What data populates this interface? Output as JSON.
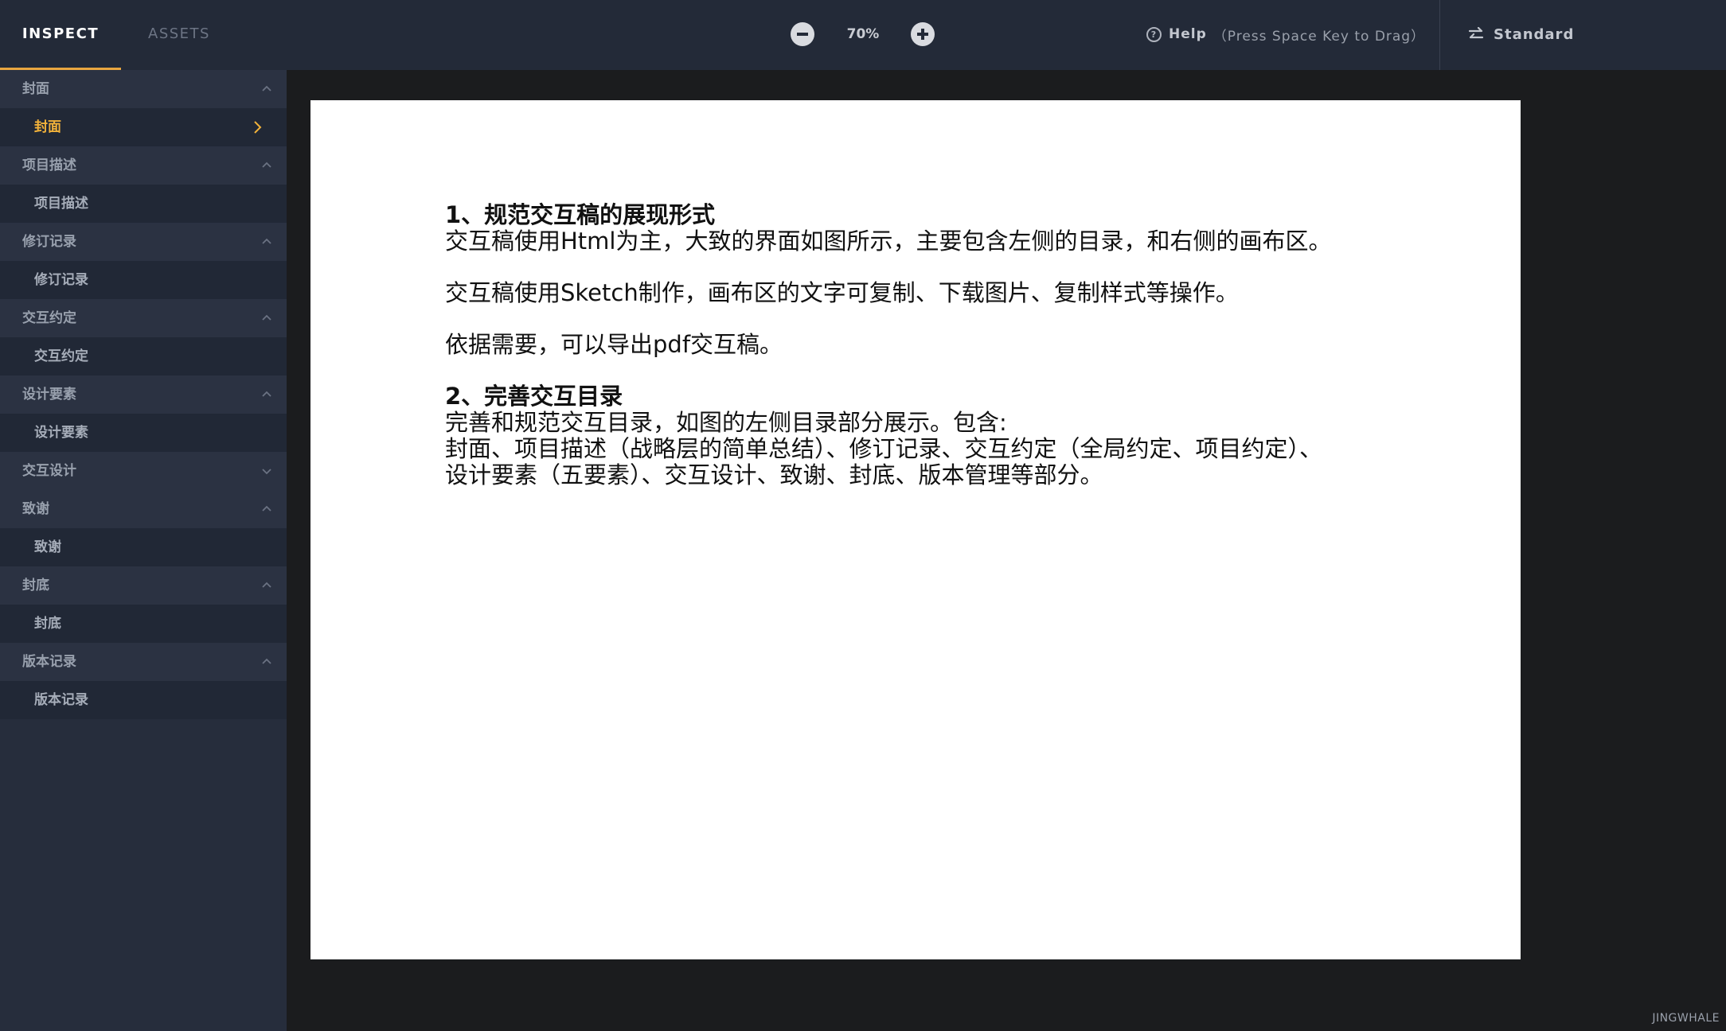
{
  "topbar": {
    "tabs": [
      "INSPECT",
      "ASSETS"
    ],
    "zoom": "70%",
    "help_label": "Help",
    "help_hint": "（Press Space Key to Drag）",
    "mode_label": "Standard"
  },
  "sidebar": {
    "groups": [
      {
        "title": "封面",
        "item": "封面"
      },
      {
        "title": "项目描述",
        "item": "项目描述"
      },
      {
        "title": "修订记录",
        "item": "修订记录"
      },
      {
        "title": "交互约定",
        "item": "交互约定"
      },
      {
        "title": "设计要素",
        "item": "设计要素"
      },
      {
        "title": "交互设计"
      },
      {
        "title": "致谢",
        "item": "致谢"
      },
      {
        "title": "封底",
        "item": "封底"
      },
      {
        "title": "版本记录",
        "item": "版本记录"
      }
    ]
  },
  "artboard": {
    "heading1": "1、规范交互稿的展现形式",
    "para1": "交互稿使用Html为主，大致的界面如图所示，主要包含左侧的目录，和右侧的画布区。",
    "para2": "交互稿使用Sketch制作，画布区的文字可复制、下载图片、复制样式等操作。",
    "para3": "依据需要，可以导出pdf交互稿。",
    "heading2": "2、完善交互目录",
    "para4": "完善和规范交互目录，如图的左侧目录部分展示。包含:",
    "para5": "封面、项目描述（战略层的简单总结）、修订记录、交互约定（全局约定、项目约定）、",
    "para6": "设计要素（五要素）、交互设计、致谢、封底、版本管理等部分。"
  },
  "watermark": "JINGWHALE",
  "colors": {
    "accent": "#e8a640",
    "active_item": "#f2b23a",
    "topbar_bg": "#232a38",
    "sidebar_bg": "#262d3c",
    "canvas_bg": "#1b1c1e"
  }
}
